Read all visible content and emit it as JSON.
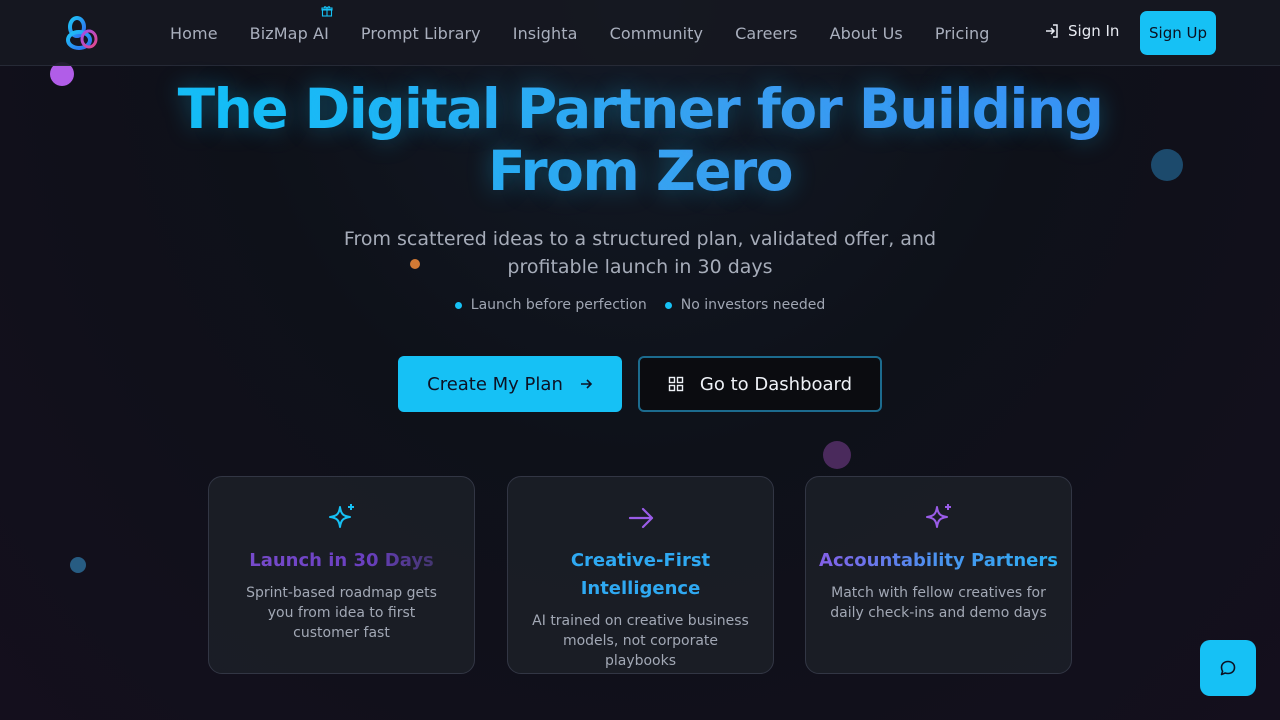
{
  "nav": {
    "links": [
      {
        "label": "Home"
      },
      {
        "label": "BizMap AI"
      },
      {
        "label": "Prompt Library"
      },
      {
        "label": "Insighta"
      },
      {
        "label": "Community"
      },
      {
        "label": "Careers"
      },
      {
        "label": "About Us"
      },
      {
        "label": "Pricing"
      }
    ],
    "sign_in": "Sign In",
    "sign_up": "Sign Up"
  },
  "hero": {
    "title_line1": "The Digital Partner for Building",
    "title_line2": "From Zero",
    "subtitle_line1": "From scattered ideas to a structured plan, validated offer, and",
    "subtitle_line2": "profitable launch in 30 days",
    "bullets": [
      "Launch before perfection",
      "No investors needed"
    ],
    "primary_cta": "Create My Plan",
    "secondary_cta": "Go to Dashboard"
  },
  "cards": [
    {
      "icon": "sparkles-icon",
      "title": "Launch in 30 Days",
      "description": "Sprint-based roadmap gets you from idea to first customer fast"
    },
    {
      "icon": "arrow-right-icon",
      "title": "Creative-First Intelligence",
      "description": "AI trained on creative business models, not corporate playbooks"
    },
    {
      "icon": "sparkles-icon",
      "title": "Accountability Partners",
      "description": "Match with fellow creatives for daily check-ins and demo days"
    }
  ],
  "colors": {
    "accent": "#16c1f5",
    "purple": "#9a5ce8",
    "blue": "#3f9cf0",
    "background": "#0e1119"
  }
}
